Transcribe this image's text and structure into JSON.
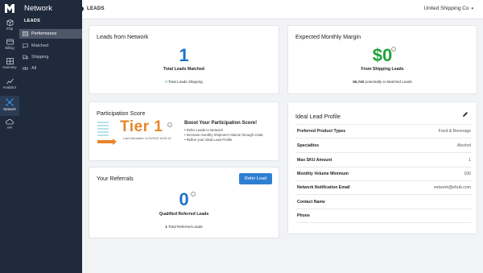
{
  "rail": {
    "items": [
      {
        "label": "Ship",
        "icon": "box-icon"
      },
      {
        "label": "Billing",
        "icon": "billing-icon"
      },
      {
        "label": "Inventory",
        "icon": "inventory-icon"
      },
      {
        "label": "Analytics",
        "icon": "analytics-icon"
      },
      {
        "label": "Network",
        "icon": "network-icon",
        "active": true
      },
      {
        "label": "API",
        "icon": "cloud-icon"
      }
    ]
  },
  "sidebar": {
    "title": "Network",
    "section": "LEADS",
    "items": [
      {
        "label": "Performance",
        "icon": "document-icon",
        "active": true
      },
      {
        "label": "Matched",
        "icon": "message-icon"
      },
      {
        "label": "Shipping",
        "icon": "truck-icon"
      },
      {
        "label": "All",
        "icon": "link-icon"
      }
    ]
  },
  "topbar": {
    "crumb": "LEADS",
    "account": "United Shipping Co"
  },
  "leads_from_network": {
    "title": "Leads from Network",
    "count": "1",
    "count_label": "Total Leads Matched",
    "shipping_count": "0",
    "shipping_label": "Total Leads Shipping"
  },
  "margin": {
    "title": "Expected Monthly Margin",
    "value": "$0",
    "value_label": "From Shipping Leads",
    "potential_amount": "$6,740",
    "potential_label": "potentially in Matched Leads"
  },
  "participation": {
    "title": "Participation Score",
    "tier": "Tier 1",
    "last_calculated": "Last Calculated: 11/11/2024 10:00:14",
    "boost_title": "Boost Your Participation Score!",
    "tips": [
      "Refer Leads to Network",
      "Increase monthly Shipment Volume through eHub",
      "Refine your Ideal Lead Profile"
    ]
  },
  "referrals": {
    "title": "Your Referrals",
    "button": "Refer Lead",
    "count": "0",
    "count_label": "Qualified Referred Leads",
    "total_count": "1",
    "total_label": "Total Referred Leads"
  },
  "profile": {
    "title": "Ideal Lead Profile",
    "rows": [
      {
        "key": "Preferred Product Types",
        "value": "Food & Beverage"
      },
      {
        "key": "Specialties",
        "value": "Alcohol"
      },
      {
        "key": "Max SKU Amount",
        "value": "1"
      },
      {
        "key": "Monthly Volume Minimum",
        "value": "100"
      },
      {
        "key": "Network Notification Email",
        "value": "network@ehub.com"
      },
      {
        "key": "Contact Name",
        "value": ""
      },
      {
        "key": "Phone",
        "value": ""
      }
    ]
  },
  "colors": {
    "nav_bg": "#1f2a3c",
    "accent_blue": "#1e73c8",
    "margin_green": "#23a23a",
    "tier_orange": "#e8852a"
  }
}
